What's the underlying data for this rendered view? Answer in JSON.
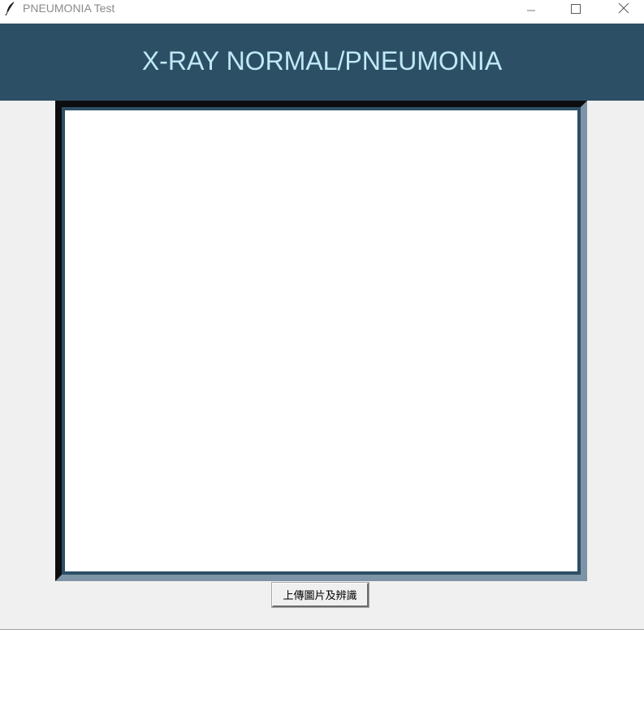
{
  "window": {
    "title": "PNEUMONIA Test",
    "icon": "feather-icon",
    "controls": {
      "minimize_icon": "minimize-icon",
      "maximize_icon": "maximize-icon",
      "close_icon": "close-icon"
    }
  },
  "header": {
    "title": "X-RAY NORMAL/PNEUMONIA",
    "background_color": "#2d4f66",
    "text_color": "#bfeaf5"
  },
  "main": {
    "background_color": "#f0f0f0",
    "image_panel_color": "#ffffff",
    "upload_button_label": "上傳圖片及辨識"
  }
}
